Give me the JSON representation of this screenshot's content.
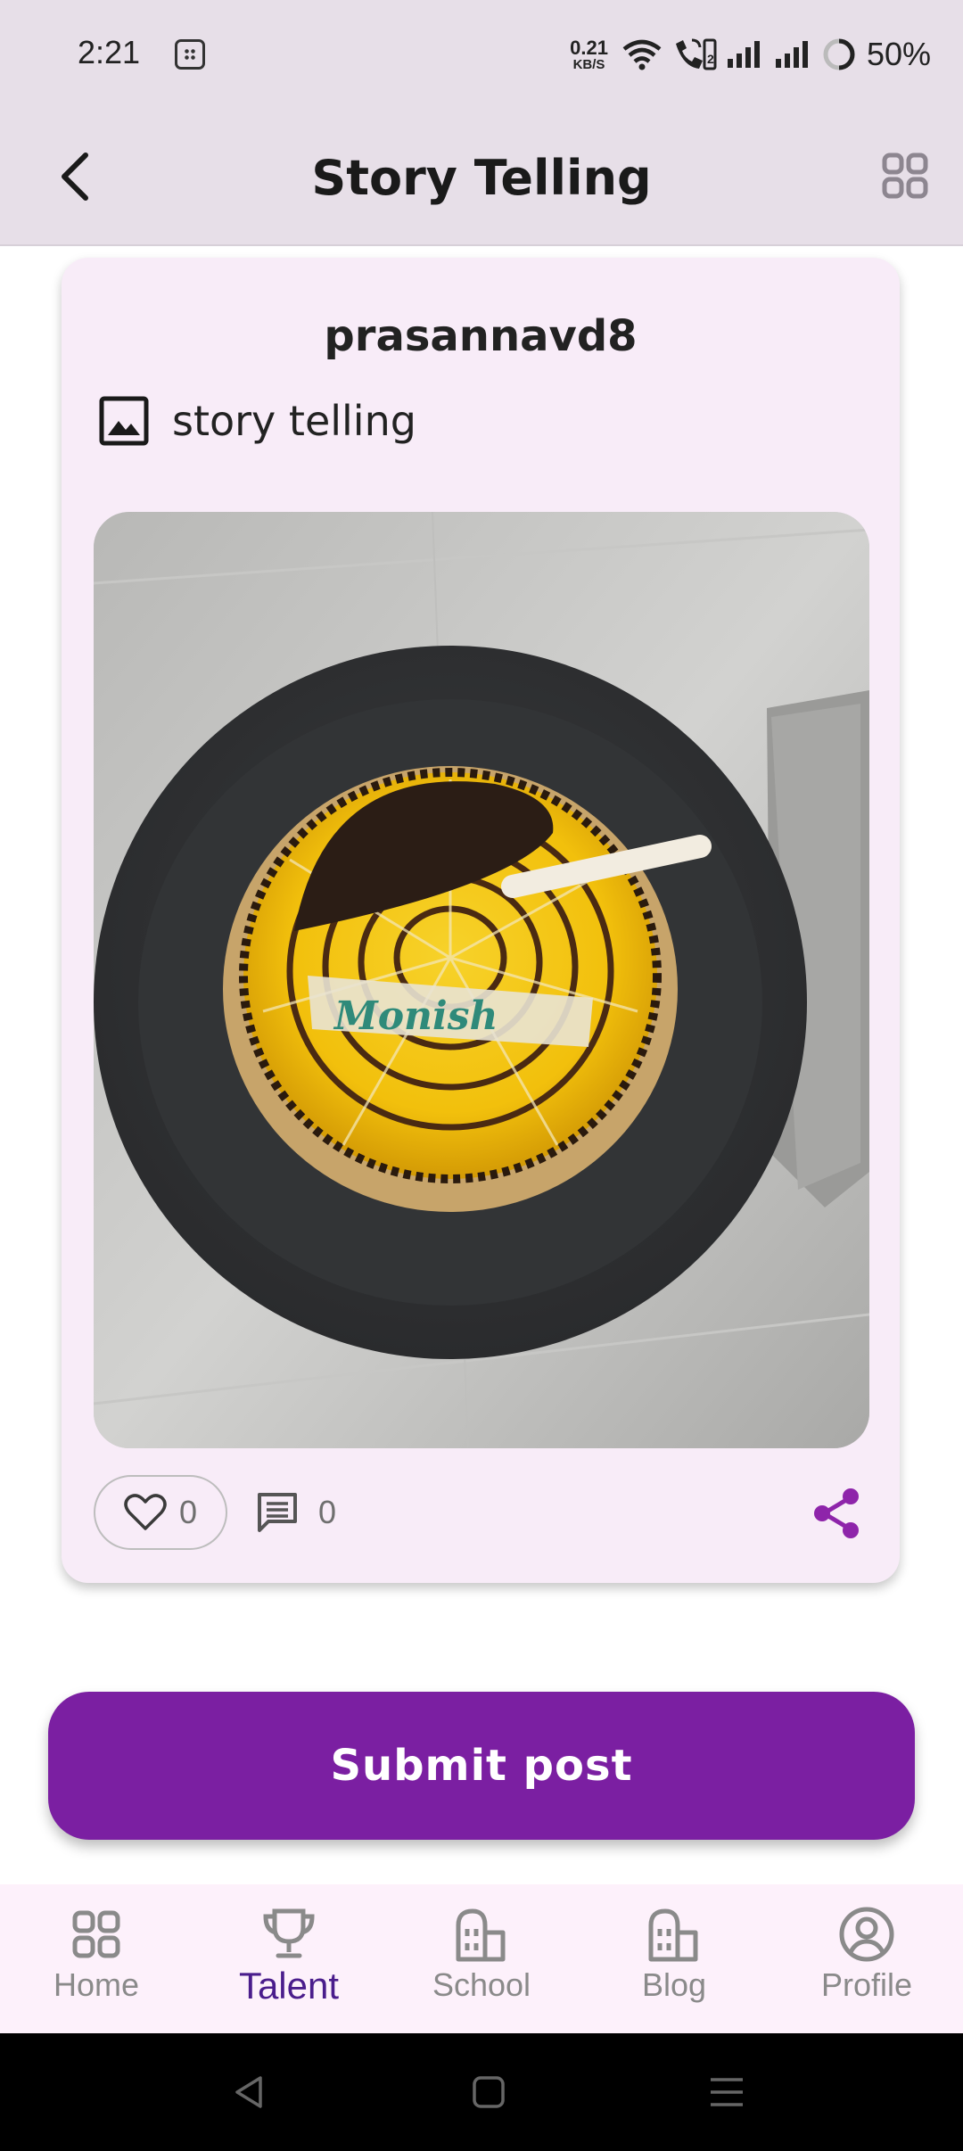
{
  "status_bar": {
    "time": "2:21",
    "net_speed_value": "0.21",
    "net_speed_unit": "KB/S",
    "battery": "50%"
  },
  "app_bar": {
    "title": "Story Telling"
  },
  "post": {
    "username": "prasannavd8",
    "category_label": "story telling",
    "likes": "0",
    "comments": "0"
  },
  "submit_label": "Submit post",
  "bottom_nav": {
    "items": [
      {
        "label": "Home",
        "icon": "grid-icon"
      },
      {
        "label": "Talent",
        "icon": "trophy-icon",
        "active": true
      },
      {
        "label": "School",
        "icon": "building-icon"
      },
      {
        "label": "Blog",
        "icon": "building-icon"
      },
      {
        "label": "Profile",
        "icon": "account-circle-icon"
      }
    ]
  },
  "colors": {
    "accent": "#7b1fa2",
    "app_bar_bg": "#e7dfe8",
    "card_bg": "#f8ecf8",
    "nav_active": "#4a1d8c"
  }
}
